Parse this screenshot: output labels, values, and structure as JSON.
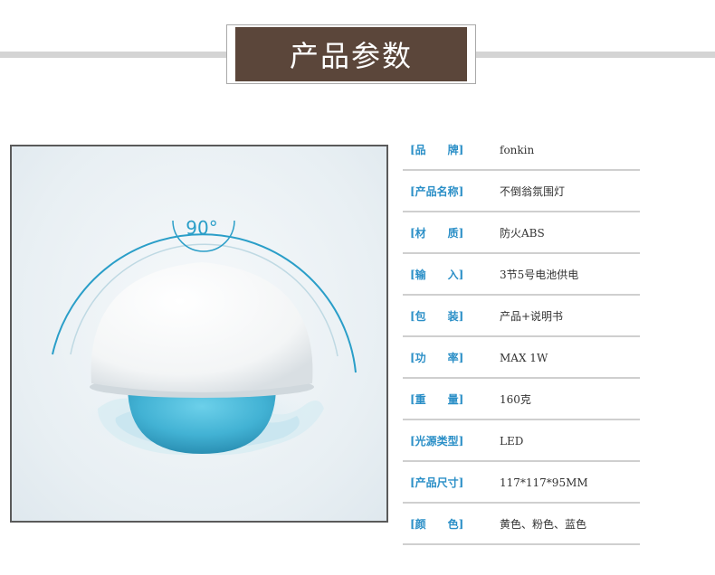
{
  "header": {
    "title": "产品参数"
  },
  "photo": {
    "angle_label": "90°"
  },
  "specs": [
    {
      "label": "[品　　牌]",
      "value": "fonkin"
    },
    {
      "label": "[产品名称]",
      "value": "不倒翁氛围灯"
    },
    {
      "label": "[材　　质]",
      "value": "防火ABS"
    },
    {
      "label": "[输　　入]",
      "value": "3节5号电池供电"
    },
    {
      "label": "[包　　装]",
      "value": "产品+说明书"
    },
    {
      "label": "[功　　率]",
      "value": "MAX 1W"
    },
    {
      "label": "[重　　量]",
      "value": "160克"
    },
    {
      "label": "[光源类型]",
      "value": "LED"
    },
    {
      "label": "[产品尺寸]",
      "value": "117*117*95MM"
    },
    {
      "label": "[颜　　色]",
      "value": "黄色、粉色、蓝色"
    }
  ],
  "colors": {
    "title_bg": "#5b463a",
    "label_blue": "#2b8fc7",
    "lamp_base": "#45b3d3",
    "arc_blue": "#2a9ec8"
  }
}
